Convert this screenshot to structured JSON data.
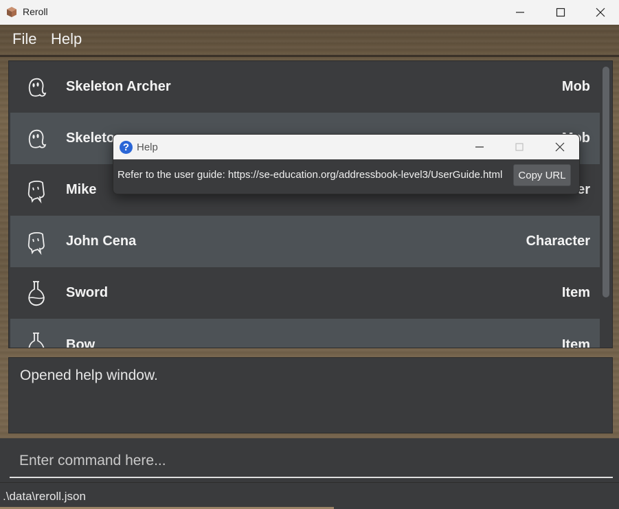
{
  "window": {
    "title": "Reroll",
    "app_icon": "cube-icon",
    "controls": [
      "minimize-icon",
      "maximize-icon",
      "close-icon"
    ]
  },
  "menu": {
    "file": "File",
    "help": "Help"
  },
  "entities": [
    {
      "name": "Skeleton Archer",
      "type": "Mob",
      "icon": "ghost-icon"
    },
    {
      "name": "Skeleton",
      "type": "Mob",
      "icon": "ghost-icon"
    },
    {
      "name": "Mike",
      "type": "Character",
      "icon": "character-icon"
    },
    {
      "name": "John Cena",
      "type": "Character",
      "icon": "character-icon"
    },
    {
      "name": "Sword",
      "type": "Item",
      "icon": "potion-icon"
    },
    {
      "name": "Bow",
      "type": "Item",
      "icon": "potion-icon"
    }
  ],
  "result": {
    "text": "Opened help window."
  },
  "command": {
    "placeholder": "Enter command here..."
  },
  "status": {
    "path": ".\\data\\reroll.json"
  },
  "help_dialog": {
    "title": "Help",
    "icon": "question-icon",
    "message": "Refer to the user guide: https://se-education.org/addressbook-level3/UserGuide.html",
    "copy_button": "Copy URL"
  },
  "colors": {
    "panel": "#3a3b3d",
    "row_alt": "#4d5256",
    "help_icon": "#2a66d6"
  }
}
